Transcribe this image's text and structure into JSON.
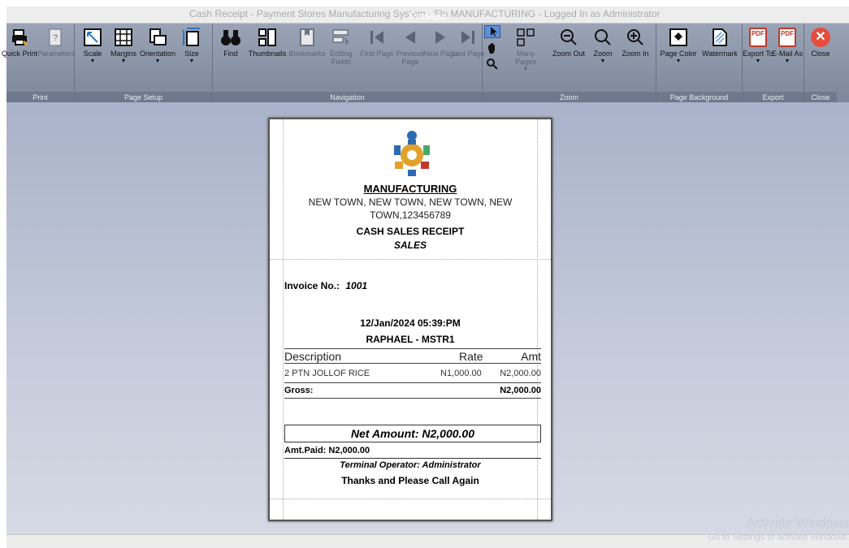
{
  "window": {
    "bg_title": "Cash Receipt - Payment Stores Manufacturing System - Flo MANUFACTURING - Logged In as Administrator",
    "preview_label": "Preview"
  },
  "ribbon": {
    "groups": {
      "print": "Print",
      "page_setup": "Page Setup",
      "navigation": "Navigation",
      "zoom": "Zoom",
      "page_background": "Page Background",
      "export": "Export",
      "close": "Close"
    },
    "buttons": {
      "quick_print": "Quick Print",
      "parameters": "Parameters",
      "scale": "Scale",
      "margins": "Margins",
      "orientation": "Orientation",
      "size": "Size",
      "find": "Find",
      "thumbnails": "Thumbnails",
      "bookmarks": "Bookmarks",
      "editing_fields": "Editing Fields",
      "first_page": "First Page",
      "previous_page": "Previous Page",
      "next_page": "Next Page",
      "last_page": "Last Page",
      "many_pages": "Many Pages",
      "zoom_out": "Zoom Out",
      "zoom": "Zoom",
      "zoom_in": "Zoom In",
      "page_color": "Page Color",
      "watermark": "Watermark",
      "export_to": "Export To",
      "email_as": "E-Mail As",
      "close": "Close"
    }
  },
  "receipt": {
    "company": "MANUFACTURING",
    "address_line1": "NEW TOWN, NEW TOWN, NEW TOWN, NEW",
    "address_line2": "TOWN,123456789",
    "title": "CASH SALES RECEIPT",
    "subtitle": "SALES",
    "invoice_label": "Invoice No.:",
    "invoice_no": "1001",
    "datetime": "12/Jan/2024 05:39:PM",
    "operator_line": "RAPHAEL - MSTR1",
    "columns": {
      "description": "Description",
      "rate": "Rate",
      "amt": "Amt"
    },
    "items": [
      {
        "description": "2 PTN JOLLOF RICE",
        "rate": "N1,000.00",
        "amt": "N2,000.00"
      }
    ],
    "gross_label": "Gross:",
    "gross_value": "N2,000.00",
    "net_amount": "Net Amount: N2,000.00",
    "amt_paid": "Amt.Paid: N2,000.00",
    "terminal_operator": "Terminal Operator: Administrator",
    "thanks": "Thanks and Please Call Again"
  },
  "watermark": {
    "line1": "Activate Windows",
    "line2": "Go to Settings to activate Windows."
  }
}
